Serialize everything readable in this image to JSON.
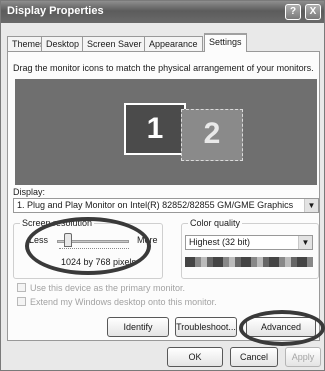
{
  "window": {
    "title": "Display Properties",
    "help_glyph": "?",
    "close_glyph": "X"
  },
  "tabs": [
    "Themes",
    "Desktop",
    "Screen Saver",
    "Appearance",
    "Settings"
  ],
  "settings": {
    "instruction": "Drag the monitor icons to match the physical arrangement of your monitors.",
    "monitors": [
      "1",
      "2"
    ],
    "display_label": "Display:",
    "display_value": "1. Plug and Play Monitor on Intel(R) 82852/82855 GM/GME Graphics",
    "screen_resolution": {
      "label": "Screen resolution",
      "less": "Less",
      "more": "More",
      "value": "1024 by 768 pixels"
    },
    "color_quality": {
      "label": "Color quality",
      "value": "Highest (32 bit)"
    },
    "checkbox_primary": "Use this device as the primary monitor.",
    "checkbox_extend": "Extend my Windows desktop onto this monitor."
  },
  "buttons": {
    "identify": "Identify",
    "troubleshoot": "Troubleshoot...",
    "advanced": "Advanced",
    "ok": "OK",
    "cancel": "Cancel",
    "apply": "Apply"
  }
}
